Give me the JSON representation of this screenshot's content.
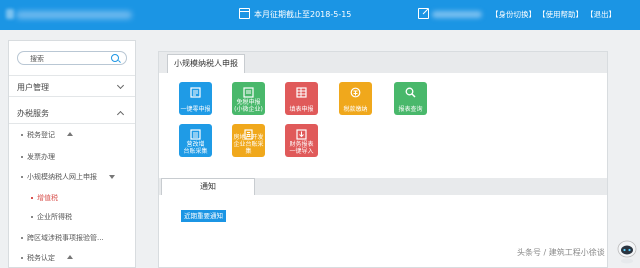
{
  "header": {
    "deadline_text": "本月征期截止至2018-5-15",
    "links": [
      "【身份切换】",
      "【使用帮助】",
      "【退出】"
    ]
  },
  "sidebar": {
    "search_placeholder": "搜索",
    "sections": [
      {
        "label": "用户管理",
        "expanded": false
      },
      {
        "label": "办税服务",
        "expanded": true
      }
    ],
    "items": [
      {
        "label": "税务登记",
        "tri": "up"
      },
      {
        "label": "发票办理"
      },
      {
        "label": "小规模纳税人网上申报",
        "tri": "down"
      },
      {
        "label": "增值税",
        "active": true
      },
      {
        "label": "企业所得税"
      },
      {
        "label": "跨区域涉税事项报验管..."
      },
      {
        "label": "税务认定",
        "tri": "up"
      }
    ]
  },
  "main": {
    "tab_title": "小规模纳税人申报",
    "tiles": [
      {
        "line1": "一键零申报",
        "line2": "",
        "color": "#1f9be6"
      },
      {
        "line1": "免税申报",
        "line2": "(小微企业)",
        "color": "#49b86b"
      },
      {
        "line1": "填表申报",
        "line2": "",
        "color": "#e05a5a"
      },
      {
        "line1": "税款缴纳",
        "line2": "",
        "color": "#f0a81c"
      },
      {
        "line1": "报表查询",
        "line2": "",
        "color": "#49b86b"
      },
      {
        "line1": "营改增",
        "line2": "台账采集",
        "color": "#1f9be6"
      },
      {
        "line1": "房地产开发",
        "line2": "企业台账采集",
        "color": "#f0a81c"
      },
      {
        "line1": "财务报表",
        "line2": "一键导入",
        "color": "#e05a5a"
      }
    ],
    "notice_tab": "通知",
    "notice_button": "近期重要通知"
  },
  "watermark": "头条号 / 建筑工程小徐谈"
}
